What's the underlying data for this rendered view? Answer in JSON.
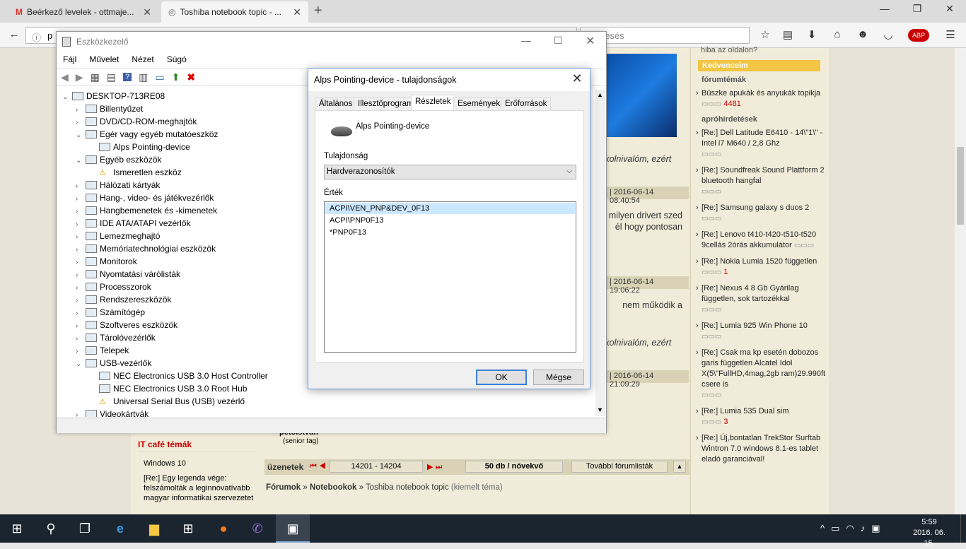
{
  "browser": {
    "tabs": [
      {
        "label": "Beérkező levelek - ottmaje..."
      },
      {
        "label": "Toshiba notebook topic - ..."
      }
    ],
    "url_visible": "p",
    "search_placeholder": "Keresés",
    "search_partial": "resés"
  },
  "web": {
    "right_top": "hiba az oldalon?",
    "kedvenceim": "Kedvenceim",
    "forumtemak_head": "fórumtémák",
    "forumtema_items": [
      {
        "text": "Büszke apukák és anyukák topikja",
        "count": "4481"
      }
    ],
    "aprohird_head": "apróhirdetések",
    "aprohird_items": [
      {
        "text": "[Re:] Dell Latitude E6410 - 14\\\"1\\\" - Intel i7 M640 / 2,8 Ghz",
        "count": ""
      },
      {
        "text": "[Re:] Soundfreak Sound Plattform 2 bluetooth hangfal",
        "count": ""
      },
      {
        "text": "[Re:] Samsung galaxy s duos 2",
        "count": ""
      },
      {
        "text": "[Re:] Lenovo t410-t420-t510-t520 9cellás 2órás akkumulátor",
        "count": ""
      },
      {
        "text": "[Re:] Nokia Lumia 1520 független",
        "count": "1"
      },
      {
        "text": "[Re:] Nexus 4 8 Gb Gyárilag független, sok tartozékkal",
        "count": ""
      },
      {
        "text": "[Re:] Lumia 925 Win Phone 10",
        "count": ""
      },
      {
        "text": "[Re:] Csak ma kp esetén dobozos garis független Alcatel Idol X(5\\\"FullHD,4mag,2gb ram)29.990ft csere is",
        "count": ""
      },
      {
        "text": "[Re:] Lumia 535 Dual sim",
        "count": "3"
      },
      {
        "text": "[Re:] Új,bontatlan TrekStor Surftab Wintron 7.0 windows 8.1-es tablet eladó garanciával!",
        "count": ""
      }
    ],
    "posts": [
      {
        "fragment": "étkolnivalóm, ezért",
        "date": "2016-06-14 08:40:54"
      },
      {
        "fragment2": "milyen drivert szed / él hogy pontosan",
        "date": "2016-06-14 19:06:22"
      },
      {
        "fragment3": "nem működik a",
        "date": "2016-06-14 21:09:29"
      },
      {
        "fragment4": "étkolnivalóm, ezért"
      }
    ],
    "frag_a": "étkolnivalóm, ezért",
    "frag_b1": "milyen drivert szed",
    "frag_b2": "él hogy pontosan",
    "frag_c": "nem működik a",
    "frag_d": "étkolnivalóm, ezért",
    "date1": "| 2016-06-14 08:40:54",
    "date2": "| 2016-06-14 19:06:22",
    "date3": "| 2016-06-14 21:09:29",
    "user": "petolstvan",
    "user_rank": "(senior tag)",
    "itcafe_head": "IT café témák",
    "itcafe_items": [
      "Windows 10",
      "[Re:] Egy legenda vége: felszámolták a leginnovatívabb magyar informatikai szervezetet"
    ],
    "uzenetek": "üzenetek",
    "range": "14201 - 14204",
    "perpage": "50 db / növekvő",
    "more_lists": "További fórumlisták",
    "crumb1": "Fórumok",
    "crumb2": "Notebookok",
    "crumb3": "Toshiba notebook topic",
    "crumb3_note": "(kiemelt téma)"
  },
  "devmgr": {
    "title": "Eszközkezelő",
    "menu": [
      "Fájl",
      "Művelet",
      "Nézet",
      "Súgó"
    ],
    "tree": [
      {
        "label": "DESKTOP-713RE08",
        "level": 0,
        "exp": "open"
      },
      {
        "label": "Billentyűzet",
        "level": 1,
        "exp": "closed"
      },
      {
        "label": "DVD/CD-ROM-meghajtók",
        "level": 1,
        "exp": "closed"
      },
      {
        "label": "Egér vagy egyéb mutatóeszköz",
        "level": 1,
        "exp": "open"
      },
      {
        "label": "Alps Pointing-device",
        "level": 2,
        "exp": ""
      },
      {
        "label": "Egyéb eszközök",
        "level": 1,
        "exp": "open"
      },
      {
        "label": "Ismeretlen eszköz",
        "level": 2,
        "exp": "",
        "warn": true
      },
      {
        "label": "Hálózati kártyák",
        "level": 1,
        "exp": "closed"
      },
      {
        "label": "Hang-, video- és játékvezérlők",
        "level": 1,
        "exp": "closed"
      },
      {
        "label": "Hangbemenetek és -kimenetek",
        "level": 1,
        "exp": "closed"
      },
      {
        "label": "IDE ATA/ATAPI vezérlők",
        "level": 1,
        "exp": "closed"
      },
      {
        "label": "Lemezmeghajtó",
        "level": 1,
        "exp": "closed"
      },
      {
        "label": "Memóriatechnológiai eszközök",
        "level": 1,
        "exp": "closed"
      },
      {
        "label": "Monitorok",
        "level": 1,
        "exp": "closed"
      },
      {
        "label": "Nyomtatási várólisták",
        "level": 1,
        "exp": "closed"
      },
      {
        "label": "Processzorok",
        "level": 1,
        "exp": "closed"
      },
      {
        "label": "Rendszereszközök",
        "level": 1,
        "exp": "closed"
      },
      {
        "label": "Számítógép",
        "level": 1,
        "exp": "closed"
      },
      {
        "label": "Szoftveres eszközök",
        "level": 1,
        "exp": "closed"
      },
      {
        "label": "Tárolóvezérlők",
        "level": 1,
        "exp": "closed"
      },
      {
        "label": "Telepek",
        "level": 1,
        "exp": "closed"
      },
      {
        "label": "USB-vezérlők",
        "level": 1,
        "exp": "open"
      },
      {
        "label": "NEC Electronics USB 3.0 Host Controller",
        "level": 2,
        "exp": ""
      },
      {
        "label": "NEC Electronics USB 3.0 Root Hub",
        "level": 2,
        "exp": ""
      },
      {
        "label": "Universal Serial Bus (USB) vezérlő",
        "level": 2,
        "exp": "",
        "warn": true
      },
      {
        "label": "Videokártyák",
        "level": 1,
        "exp": "closed"
      }
    ]
  },
  "props": {
    "title": "Alps Pointing-device - tulajdonságok",
    "tabs": [
      "Általános",
      "Illesztőprogram",
      "Részletek",
      "Események",
      "Erőforrások"
    ],
    "active_tab": "Részletek",
    "device_name": "Alps Pointing-device",
    "property_label": "Tulajdonság",
    "property_value": "Hardverazonosítók",
    "value_label": "Érték",
    "values": [
      "ACPI\\VEN_PNP&DEV_0F13",
      "ACPI\\PNP0F13",
      "*PNP0F13"
    ],
    "ok": "OK",
    "cancel": "Mégse"
  },
  "taskbar": {
    "time": "5:59",
    "date": "2016. 06. 15."
  }
}
